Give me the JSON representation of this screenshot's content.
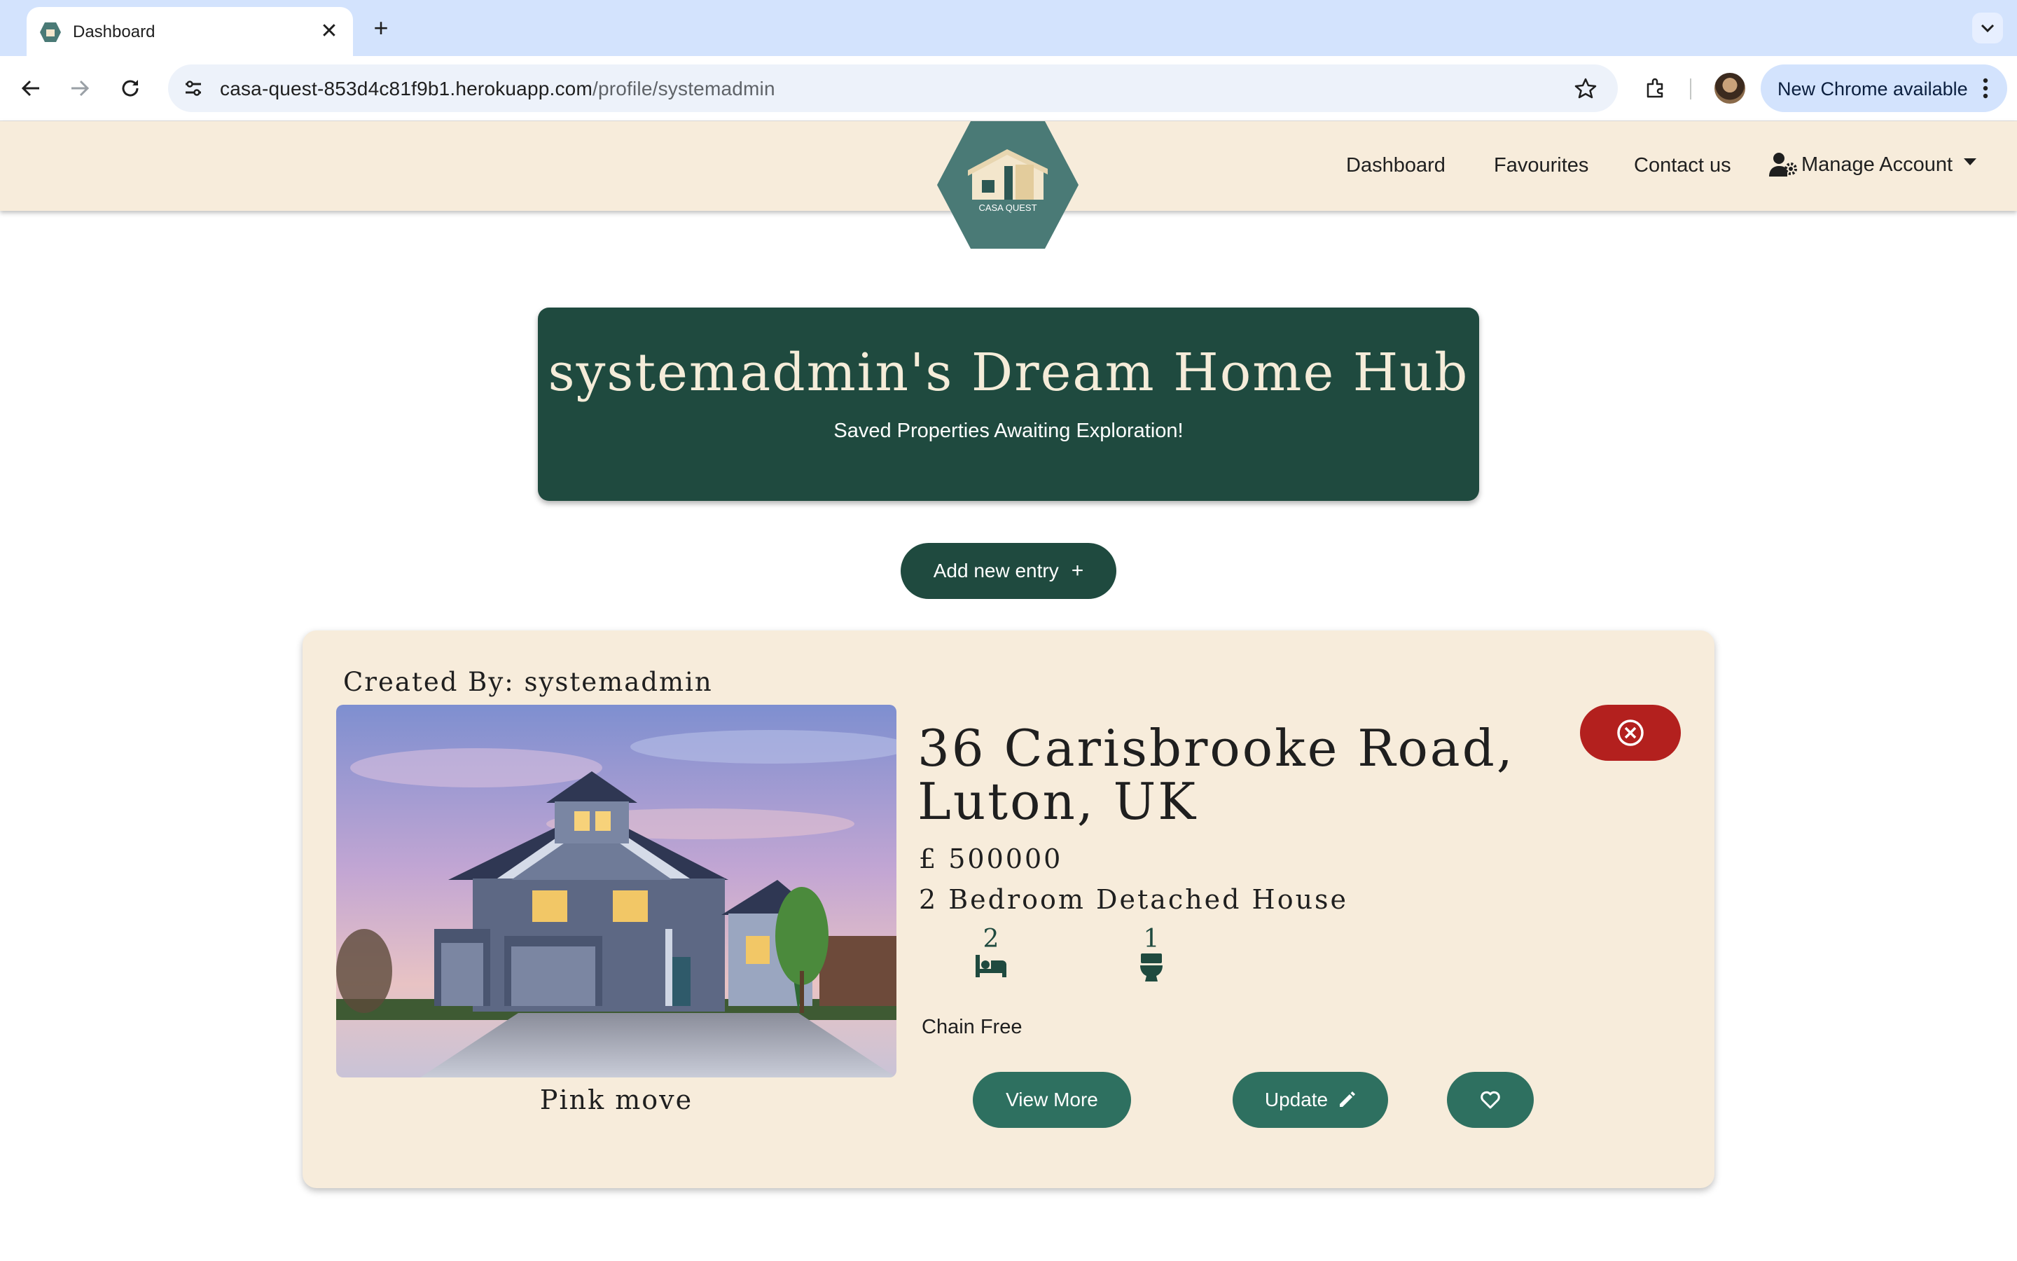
{
  "browser": {
    "tab_title": "Dashboard",
    "url_host": "casa-quest-853d4c81f9b1.herokuapp.com",
    "url_path": "/profile/systemadmin",
    "update_chip": "New Chrome available"
  },
  "nav": {
    "logo_text": "CASA QUEST",
    "links": [
      "Dashboard",
      "Favourites",
      "Contact us"
    ],
    "manage_account": "Manage Account"
  },
  "hero": {
    "title": "systemadmin's Dream Home Hub",
    "subtitle": "Saved Properties Awaiting Exploration!"
  },
  "add_button": {
    "label": "Add new entry",
    "icon": "+"
  },
  "card": {
    "created_by": "Created By: systemadmin",
    "caption": "Pink move",
    "address": "36 Carisbrooke Road, Luton, UK",
    "price": "£ 500000",
    "property_type": "2 Bedroom Detached House",
    "bedrooms": "2",
    "bathrooms": "1",
    "chain_status": "Chain Free",
    "buttons": {
      "view_more": "View More",
      "update": "Update"
    }
  },
  "colors": {
    "brand_dark": "#1f4a3f",
    "brand_button": "#2e7060",
    "cream": "#f7ecdb",
    "delete_red": "#b3201e",
    "chrome_blue": "#d3e3fd"
  },
  "icons": [
    "favicon-icon",
    "close-icon",
    "new-tab-icon",
    "tab-search-icon",
    "back-icon",
    "forward-icon",
    "reload-icon",
    "site-settings-icon",
    "bookmark-star-icon",
    "extensions-icon",
    "kebab-menu-icon",
    "user-gear-icon",
    "bed-icon",
    "toilet-icon",
    "pencil-icon",
    "heart-icon",
    "circle-x-icon"
  ]
}
